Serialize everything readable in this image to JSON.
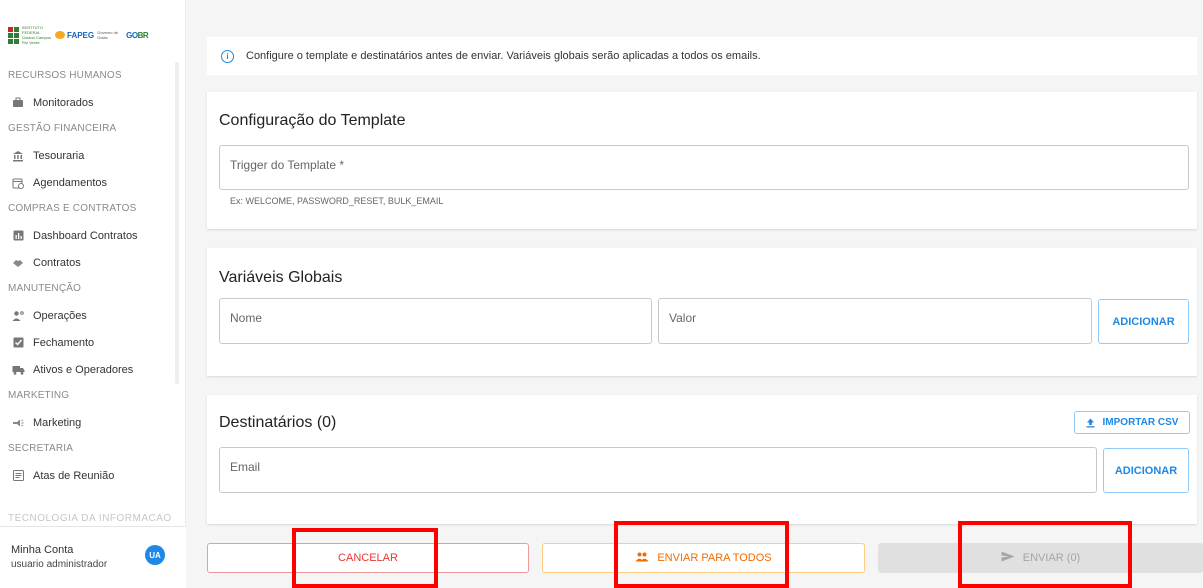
{
  "sidebar": {
    "logo": {
      "institute_text": "INSTITUTO FEDERAL Goiano Campus Rio Verde",
      "fapeg_text": "FAPEG",
      "gov_text": "Governo de Goiás",
      "br_text": "GO",
      "br_suffix": "BR"
    },
    "sections": [
      {
        "title": "RECURSOS HUMANOS",
        "items": [
          {
            "label": "Monitorados",
            "icon": "people-icon"
          }
        ]
      },
      {
        "title": "GESTÃO FINANCEIRA",
        "items": [
          {
            "label": "Tesouraria",
            "icon": "bank-icon"
          },
          {
            "label": "Agendamentos",
            "icon": "calendar-clock-icon"
          }
        ]
      },
      {
        "title": "COMPRAS E CONTRATOS",
        "items": [
          {
            "label": "Dashboard Contratos",
            "icon": "dashboard-icon"
          },
          {
            "label": "Contratos",
            "icon": "handshake-icon"
          }
        ]
      },
      {
        "title": "MANUTENÇÃO",
        "items": [
          {
            "label": "Operações",
            "icon": "engineering-icon"
          },
          {
            "label": "Fechamento",
            "icon": "checkbox-icon"
          },
          {
            "label": "Ativos e Operadores",
            "icon": "truck-icon"
          }
        ]
      },
      {
        "title": "MARKETING",
        "items": [
          {
            "label": "Marketing",
            "icon": "megaphone-icon"
          }
        ]
      },
      {
        "title": "SECRETARIA",
        "items": [
          {
            "label": "Atas de Reunião",
            "icon": "document-icon"
          }
        ]
      }
    ],
    "partial_section": "TECNOLOGIA DA INFORMAÇÃO",
    "account": {
      "title": "Minha Conta",
      "user": "usuario administrador",
      "initials": "UA"
    }
  },
  "info": {
    "text": "Configure o template e destinatários antes de enviar. Variáveis globais serão aplicadas a todos os emails."
  },
  "template_card": {
    "title": "Configuração do Template",
    "trigger_label": "Trigger do Template *",
    "helper": "Ex: WELCOME, PASSWORD_RESET, BULK_EMAIL"
  },
  "vars_card": {
    "title": "Variáveis Globais",
    "name_label": "Nome",
    "value_label": "Valor",
    "add_label": "ADICIONAR"
  },
  "recipients_card": {
    "title": "Destinatários (0)",
    "import_label": "IMPORTAR CSV",
    "email_label": "Email",
    "add_label": "ADICIONAR"
  },
  "actions": {
    "cancel_label": "CANCELAR",
    "send_all_label": "ENVIAR PARA TODOS",
    "send_label": "ENVIAR (0)"
  },
  "colors": {
    "accent": "#1e88e5",
    "cancel": "#e53935",
    "send_all": "#ef6c00",
    "disabled": "#a5a5a5",
    "highlight": "#ff0000"
  }
}
